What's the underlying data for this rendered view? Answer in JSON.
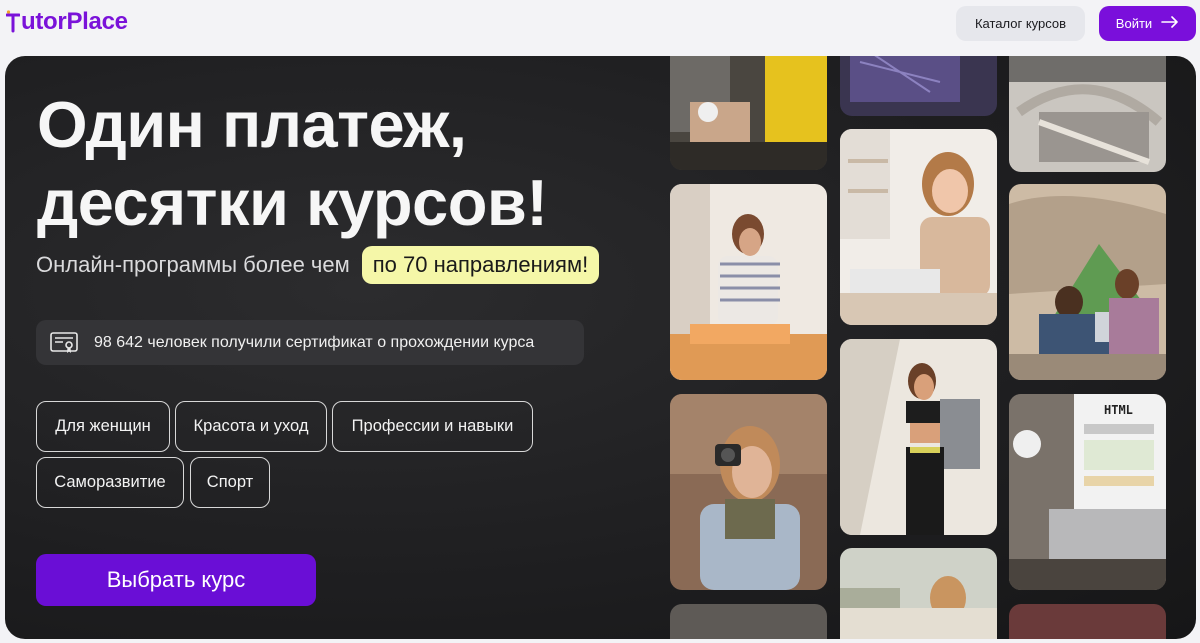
{
  "header": {
    "logo_text": "TutorPlace",
    "logo_rest": "utorPlace",
    "catalog_label": "Каталог курсов",
    "login_label": "Войти"
  },
  "hero": {
    "title_line1": "Один платеж,",
    "title_line2": "десятки курсов!",
    "subtitle": "Онлайн-программы более чем",
    "highlight": "по 70 направлениям!",
    "certificate_text": "98 642 человек получили сертификат о прохождении курса",
    "chips": [
      "Для женщин",
      "Красота и уход",
      "Профессии и навыки",
      "Саморазвитие",
      "Спорт"
    ],
    "cta_label": "Выбрать курс"
  },
  "colors": {
    "brand": "#7a0fdb",
    "cta": "#6a0ed6",
    "highlight": "#f5f7a8",
    "hero_bg": "#1e1e20"
  },
  "icons": {
    "logo": "logo-mark-icon",
    "login_arrow": "arrow-right-icon",
    "certificate": "certificate-icon"
  }
}
